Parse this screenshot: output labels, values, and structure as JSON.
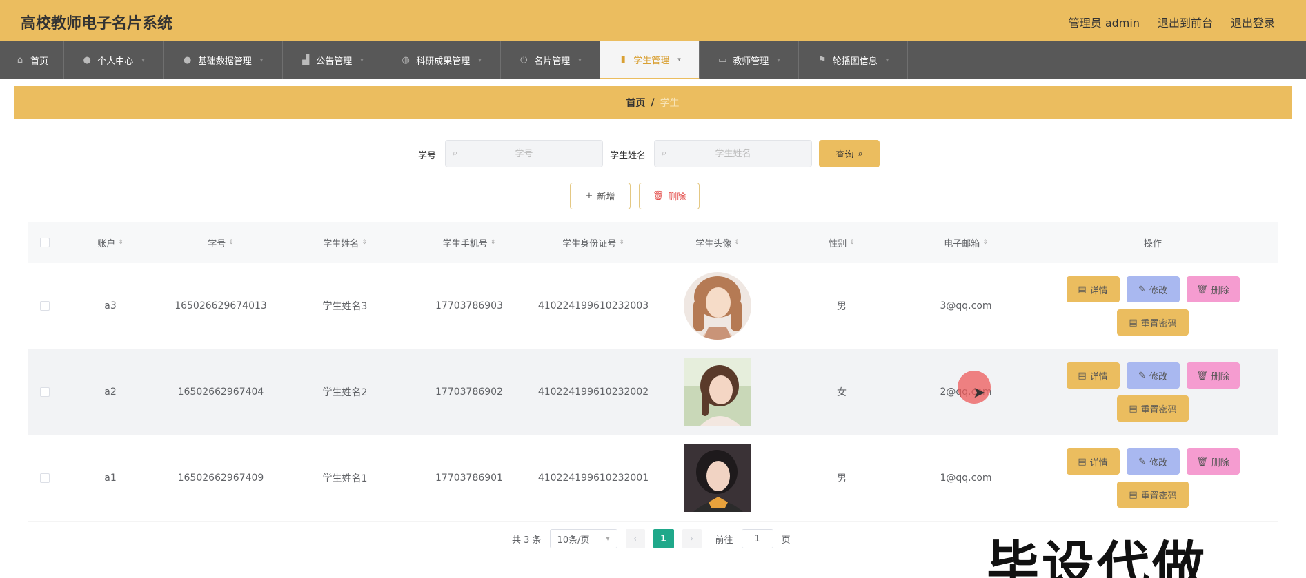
{
  "header": {
    "title": "高校教师电子名片系统",
    "admin_label": "管理员 admin",
    "to_front": "退出到前台",
    "logout": "退出登录"
  },
  "nav": {
    "items": [
      {
        "label": "首页",
        "icon": "home-icon"
      },
      {
        "label": "个人中心",
        "icon": "user-icon"
      },
      {
        "label": "基础数据管理",
        "icon": "user-icon"
      },
      {
        "label": "公告管理",
        "icon": "chart-icon"
      },
      {
        "label": "科研成果管理",
        "icon": "globe-icon"
      },
      {
        "label": "名片管理",
        "icon": "power-icon"
      },
      {
        "label": "学生管理",
        "icon": "bar-chart-icon"
      },
      {
        "label": "教师管理",
        "icon": "monitor-icon"
      },
      {
        "label": "轮播图信息",
        "icon": "flag-icon"
      }
    ],
    "active": "学生管理"
  },
  "breadcrumb": {
    "home": "首页",
    "sep": "/",
    "current": "学生"
  },
  "search": {
    "student_id_label": "学号",
    "student_id_placeholder": "学号",
    "student_name_label": "学生姓名",
    "student_name_placeholder": "学生姓名",
    "query_label": "查询"
  },
  "actions": {
    "add_label": "新增",
    "delete_label": "删除"
  },
  "table": {
    "headers": [
      "账户",
      "学号",
      "学生姓名",
      "学生手机号",
      "学生身份证号",
      "学生头像",
      "性别",
      "电子邮箱",
      "操作"
    ],
    "rows": [
      {
        "account": "a3",
        "student_id": "165026629674013",
        "name": "学生姓名3",
        "phone": "17703786903",
        "id_card": "410224199610232003",
        "gender": "男",
        "email": "3@qq.com"
      },
      {
        "account": "a2",
        "student_id": "16502662967404",
        "name": "学生姓名2",
        "phone": "17703786902",
        "id_card": "410224199610232002",
        "gender": "女",
        "email": "2@qq.com"
      },
      {
        "account": "a1",
        "student_id": "16502662967409",
        "name": "学生姓名1",
        "phone": "17703786901",
        "id_card": "410224199610232001",
        "gender": "男",
        "email": "1@qq.com"
      }
    ],
    "op_labels": {
      "detail": "详情",
      "edit": "修改",
      "delete": "删除",
      "reset": "重置密码"
    }
  },
  "pagination": {
    "total": "共 3 条",
    "page_size": "10条/页",
    "current_page": "1",
    "goto_label": "前往",
    "goto_value": "1",
    "page_suffix": "页"
  },
  "watermark": "毕设代做",
  "colors": {
    "header": "#ebbd5f",
    "nav": "#585858",
    "active_page": "#1fa88a"
  }
}
